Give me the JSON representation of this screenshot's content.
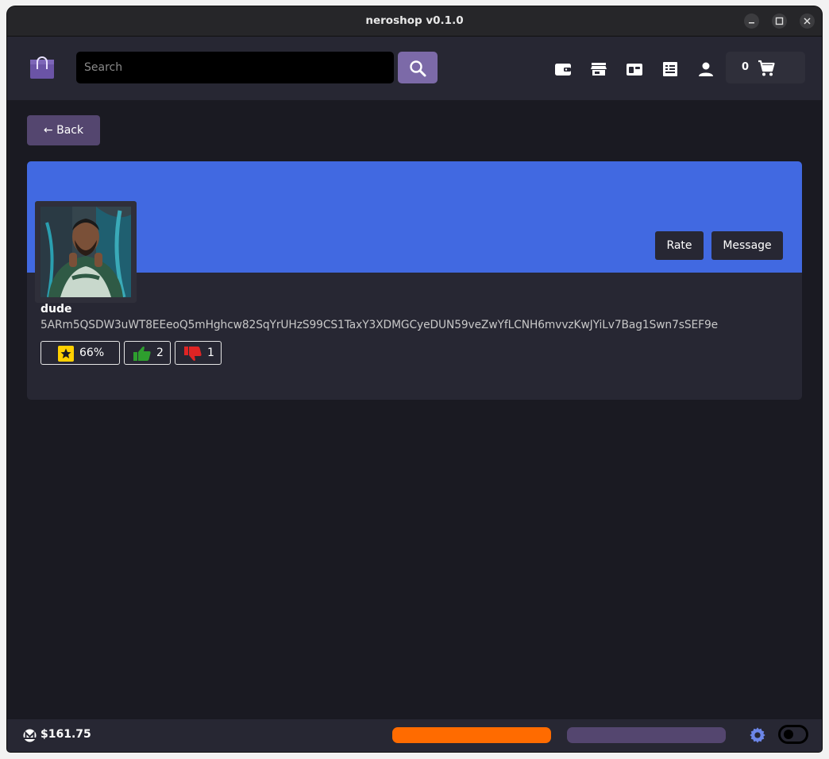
{
  "window": {
    "title": "neroshop v0.1.0"
  },
  "header": {
    "search": {
      "placeholder": "Search",
      "value": ""
    },
    "nav_icons": [
      "wallet-icon",
      "store-icon",
      "inventory-icon",
      "orders-icon",
      "account-icon"
    ],
    "cart": {
      "count": "0"
    }
  },
  "back_button": {
    "label": "← Back"
  },
  "profile": {
    "username": "dude",
    "wallet_address": "5ARm5QSDW3uWT8EEeoQ5mHghcw82SqYrUHzS99CS1TaxY3XDMGCyeDUN59veZwYfLCNH6mvvzKwJYiLv7Bag1Swn7sSEF9e",
    "rate_label": "Rate",
    "message_label": "Message",
    "reputation": "66%",
    "thumbs_up": "2",
    "thumbs_down": "1"
  },
  "footer": {
    "balance": "$161.75"
  },
  "colors": {
    "banner": "#4169e1",
    "accent": "#54466f",
    "sync_bar": "#ff6b00",
    "thumbs_up": "#2e9e2e",
    "thumbs_down": "#e02424",
    "star": "#ffd000"
  }
}
